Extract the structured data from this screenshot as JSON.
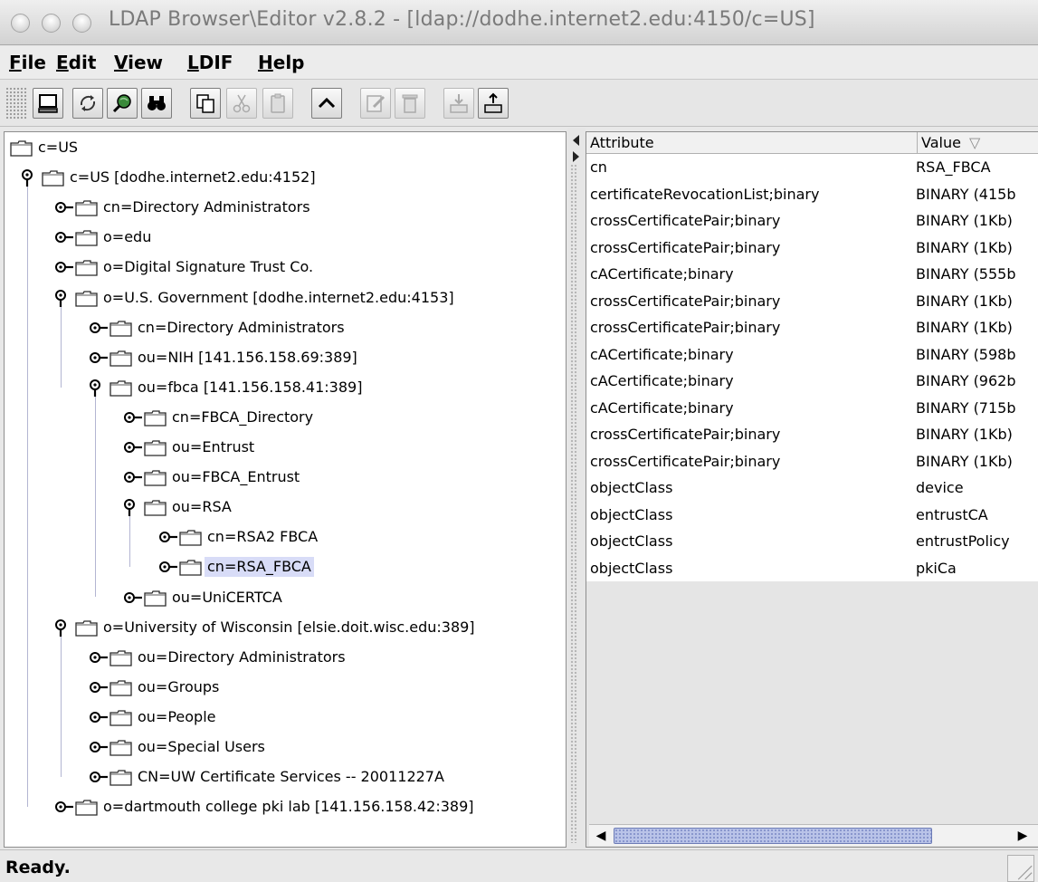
{
  "window": {
    "title": "LDAP Browser\\Editor v2.8.2 - [ldap://dodhe.internet2.edu:4150/c=US]"
  },
  "menu": [
    "File",
    "Edit",
    "View",
    "LDIF",
    "Help"
  ],
  "toolbar": {
    "buttons": [
      {
        "name": "connect-icon",
        "enabled": true
      },
      {
        "name": "refresh-icon",
        "enabled": true
      },
      {
        "name": "search-globe-icon",
        "enabled": true
      },
      {
        "name": "binoculars-icon",
        "enabled": true
      },
      {
        "name": "copy-icon",
        "enabled": true
      },
      {
        "name": "cut-icon",
        "enabled": false
      },
      {
        "name": "paste-icon",
        "enabled": false
      },
      {
        "name": "up-icon",
        "enabled": true
      },
      {
        "name": "edit-icon",
        "enabled": false
      },
      {
        "name": "delete-icon",
        "enabled": false
      },
      {
        "name": "import-icon",
        "enabled": false
      },
      {
        "name": "export-icon",
        "enabled": true
      }
    ]
  },
  "tree": [
    {
      "label": "c=US",
      "state": "none",
      "selected": false
    },
    {
      "label": "c=US [dodhe.internet2.edu:4152]",
      "state": "expanded",
      "selected": false
    },
    {
      "label": "cn=Directory Administrators",
      "state": "collapsed",
      "selected": false
    },
    {
      "label": "o=edu",
      "state": "collapsed",
      "selected": false
    },
    {
      "label": "o=Digital Signature Trust Co.",
      "state": "collapsed",
      "selected": false
    },
    {
      "label": "o=U.S. Government [dodhe.internet2.edu:4153]",
      "state": "expanded",
      "selected": false
    },
    {
      "label": "cn=Directory Administrators",
      "state": "collapsed",
      "selected": false
    },
    {
      "label": "ou=NIH [141.156.158.69:389]",
      "state": "collapsed",
      "selected": false
    },
    {
      "label": "ou=fbca [141.156.158.41:389]",
      "state": "expanded",
      "selected": false
    },
    {
      "label": "cn=FBCA_Directory",
      "state": "collapsed",
      "selected": false
    },
    {
      "label": "ou=Entrust",
      "state": "collapsed",
      "selected": false
    },
    {
      "label": "ou=FBCA_Entrust",
      "state": "collapsed",
      "selected": false
    },
    {
      "label": "ou=RSA",
      "state": "expanded",
      "selected": false
    },
    {
      "label": "cn=RSA2 FBCA",
      "state": "collapsed",
      "selected": false
    },
    {
      "label": "cn=RSA_FBCA",
      "state": "collapsed",
      "selected": true
    },
    {
      "label": "ou=UniCERTCA",
      "state": "collapsed",
      "selected": false
    },
    {
      "label": "o=University of Wisconsin [elsie.doit.wisc.edu:389]",
      "state": "expanded",
      "selected": false
    },
    {
      "label": "ou=Directory Administrators",
      "state": "collapsed",
      "selected": false
    },
    {
      "label": "ou=Groups",
      "state": "collapsed",
      "selected": false
    },
    {
      "label": "ou=People",
      "state": "collapsed",
      "selected": false
    },
    {
      "label": "ou=Special Users",
      "state": "collapsed",
      "selected": false
    },
    {
      "label": "CN=UW Certificate Services -- 20011227A",
      "state": "collapsed",
      "selected": false
    },
    {
      "label": "o=dartmouth college pki lab [141.156.158.42:389]",
      "state": "collapsed",
      "selected": false
    }
  ],
  "table": {
    "headers": [
      "Attribute",
      "Value"
    ],
    "sort_indicator": "▽",
    "rows": [
      [
        "cn",
        "RSA_FBCA"
      ],
      [
        "certificateRevocationList;binary",
        "BINARY (415b"
      ],
      [
        "crossCertificatePair;binary",
        "BINARY (1Kb)"
      ],
      [
        "crossCertificatePair;binary",
        "BINARY (1Kb)"
      ],
      [
        "cACertificate;binary",
        "BINARY (555b"
      ],
      [
        "crossCertificatePair;binary",
        "BINARY (1Kb)"
      ],
      [
        "crossCertificatePair;binary",
        "BINARY (1Kb)"
      ],
      [
        "cACertificate;binary",
        "BINARY (598b"
      ],
      [
        "cACertificate;binary",
        "BINARY (962b"
      ],
      [
        "cACertificate;binary",
        "BINARY (715b"
      ],
      [
        "crossCertificatePair;binary",
        "BINARY (1Kb)"
      ],
      [
        "crossCertificatePair;binary",
        "BINARY (1Kb)"
      ],
      [
        "objectClass",
        "device"
      ],
      [
        "objectClass",
        "entrustCA"
      ],
      [
        "objectClass",
        "entrustPolicy"
      ],
      [
        "objectClass",
        "pkiCa"
      ]
    ]
  },
  "status": {
    "text": "Ready."
  },
  "colors": {
    "selection": "#d8dcf7",
    "tree_line": "#b3b5d2",
    "scroll_thumb": "#b9c3e8"
  }
}
